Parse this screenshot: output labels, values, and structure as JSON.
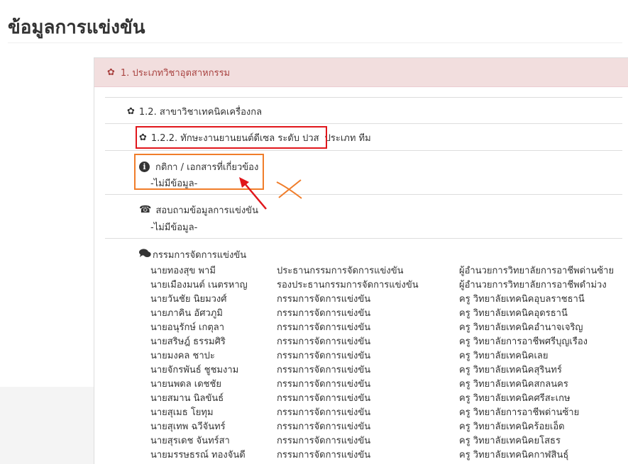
{
  "page": {
    "title": "ข้อมูลการแข่งขัน"
  },
  "category": {
    "label": "1. ประเภทวิชาอุตสาหกรรม",
    "icon": "gear-icon"
  },
  "branch": {
    "label": "1.2. สาขาวิชาเทคนิคเครื่องกล",
    "icon": "gear-icon"
  },
  "competition": {
    "label": "1.2.2. ทักษะงานยานยนต์ดีเซล ระดับ ปวส",
    "type_text": "ประเภท ทีม",
    "icon": "gear-icon"
  },
  "rules": {
    "label": "กติกา / เอกสารที่เกี่ยวข้อง",
    "value": "-ไม่มีข้อมูล-",
    "icon": "info-icon"
  },
  "contact": {
    "label": "สอบถามข้อมูลการแข่งขัน",
    "value": "-ไม่มีข้อมูล-",
    "icon": "phone-icon"
  },
  "committee": {
    "label": "กรรมการจัดการแข่งขัน",
    "icon": "comments-icon",
    "members": [
      {
        "name": "นายทองสุข พามี",
        "role": "ประธานกรรมการจัดการแข่งขัน",
        "org": "ผู้อำนวยการวิทยาลัยการอาชีพด่านซ้าย"
      },
      {
        "name": "นายเมืองมนต์ เนตรหาญ",
        "role": "รองประธานกรรมการจัดการแข่งขัน",
        "org": "ผู้อำนวยการวิทยาลัยการอาชีพดำม่วง"
      },
      {
        "name": "นายวันชัย นิยมวงศ์",
        "role": "กรรมการจัดการแข่งขัน",
        "org": "ครู วิทยาลัยเทคนิคอุบลราชธานี"
      },
      {
        "name": "นายภาคิน อัศวภูมิ",
        "role": "กรรมการจัดการแข่งขัน",
        "org": "ครู วิทยาลัยเทคนิคอุดรธานี"
      },
      {
        "name": "นายอนุรักษ์ เกตุลา",
        "role": "กรรมการจัดการแข่งขัน",
        "org": "ครู วิทยาลัยเทคนิคอำนาจเจริญ"
      },
      {
        "name": "นายสริษฎ์ ธรรมศิริ",
        "role": "กรรมการจัดการแข่งขัน",
        "org": "ครู วิทยาลัยการอาชีพศรีบุญเรือง"
      },
      {
        "name": "นายมงคล ชาปะ",
        "role": "กรรมการจัดการแข่งขัน",
        "org": "ครู วิทยาลัยเทคนิคเลย"
      },
      {
        "name": "นายจักรพันธ์ ชูชมงาม",
        "role": "กรรมการจัดการแข่งขัน",
        "org": "ครู วิทยาลัยเทคนิคสุรินทร์"
      },
      {
        "name": "นายนพดล เดชชัย",
        "role": "กรรมการจัดการแข่งขัน",
        "org": "ครู วิทยาลัยเทคนิคสกลนคร"
      },
      {
        "name": "นายสมาน นิลขันธ์",
        "role": "กรรมการจัดการแข่งขัน",
        "org": "ครู วิทยาลัยเทคนิคศรีสะเกษ"
      },
      {
        "name": "นายสุเมธ โยทุม",
        "role": "กรรมการจัดการแข่งขัน",
        "org": "ครู วิทยาลัยการอาชีพด่านซ้าย"
      },
      {
        "name": "นายสุเทพ ฉวีจันทร์",
        "role": "กรรมการจัดการแข่งขัน",
        "org": "ครู วิทยาลัยเทคนิคร้อยเอ็ด"
      },
      {
        "name": "นายสุรเดช จันทร์สา",
        "role": "กรรมการจัดการแข่งขัน",
        "org": "ครู วิทยาลัยเทคนิคยโสธร"
      },
      {
        "name": "นายมรรษธรณ์ ทองจันดี",
        "role": "กรรมการจัดการแข่งขัน",
        "org": "ครู วิทยาลัยเทคนิคกาฬสินธุ์"
      }
    ]
  },
  "colors": {
    "panel_heading_bg": "#f2dede",
    "panel_heading_text": "#a94442",
    "highlight_red": "#e0161b",
    "highlight_orange": "#f07d2a"
  }
}
